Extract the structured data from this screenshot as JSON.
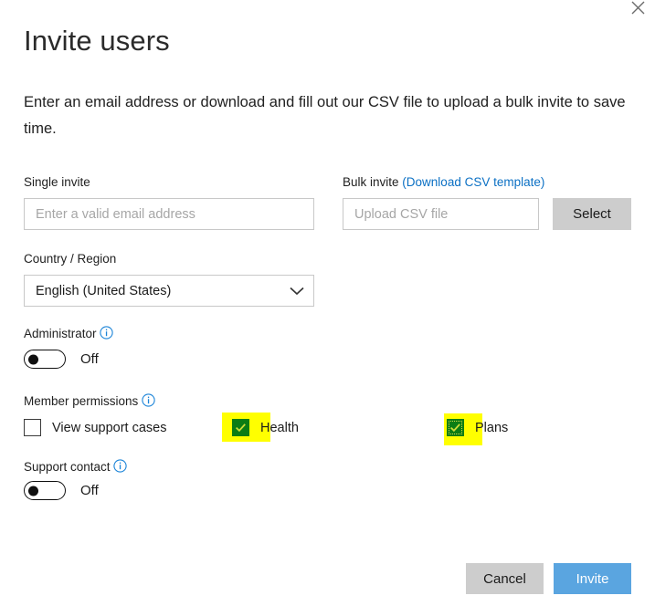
{
  "dialog": {
    "title": "Invite users",
    "description": "Enter an email address or download and fill out our CSV file to upload a bulk invite to save time.",
    "close_label": "×"
  },
  "single_invite": {
    "label": "Single invite",
    "placeholder": "Enter a valid email address",
    "value": ""
  },
  "bulk_invite": {
    "label": "Bulk invite",
    "link_label": "(Download CSV template)",
    "placeholder": "Upload CSV file",
    "value": "",
    "select_button": "Select"
  },
  "country_region": {
    "label": "Country / Region",
    "selected": "English (United States)"
  },
  "administrator": {
    "label": "Administrator",
    "state": "Off",
    "checked": false
  },
  "member_permissions": {
    "label": "Member permissions",
    "options": [
      {
        "label": "View support cases",
        "checked": false,
        "highlighted": false,
        "focused": false
      },
      {
        "label": "Health",
        "checked": true,
        "highlighted": true,
        "focused": false
      },
      {
        "label": "Plans",
        "checked": true,
        "highlighted": true,
        "focused": true
      }
    ]
  },
  "support_contact": {
    "label": "Support contact",
    "state": "Off",
    "checked": false
  },
  "footer": {
    "cancel_label": "Cancel",
    "invite_label": "Invite"
  },
  "colors": {
    "link": "#0b70c4",
    "info_icon": "#1b84d8",
    "primary_button": "#5aa5e0",
    "checkbox_checked": "#0b7d14",
    "highlight": "#ffff00",
    "grey_button": "#cdcdcd"
  }
}
